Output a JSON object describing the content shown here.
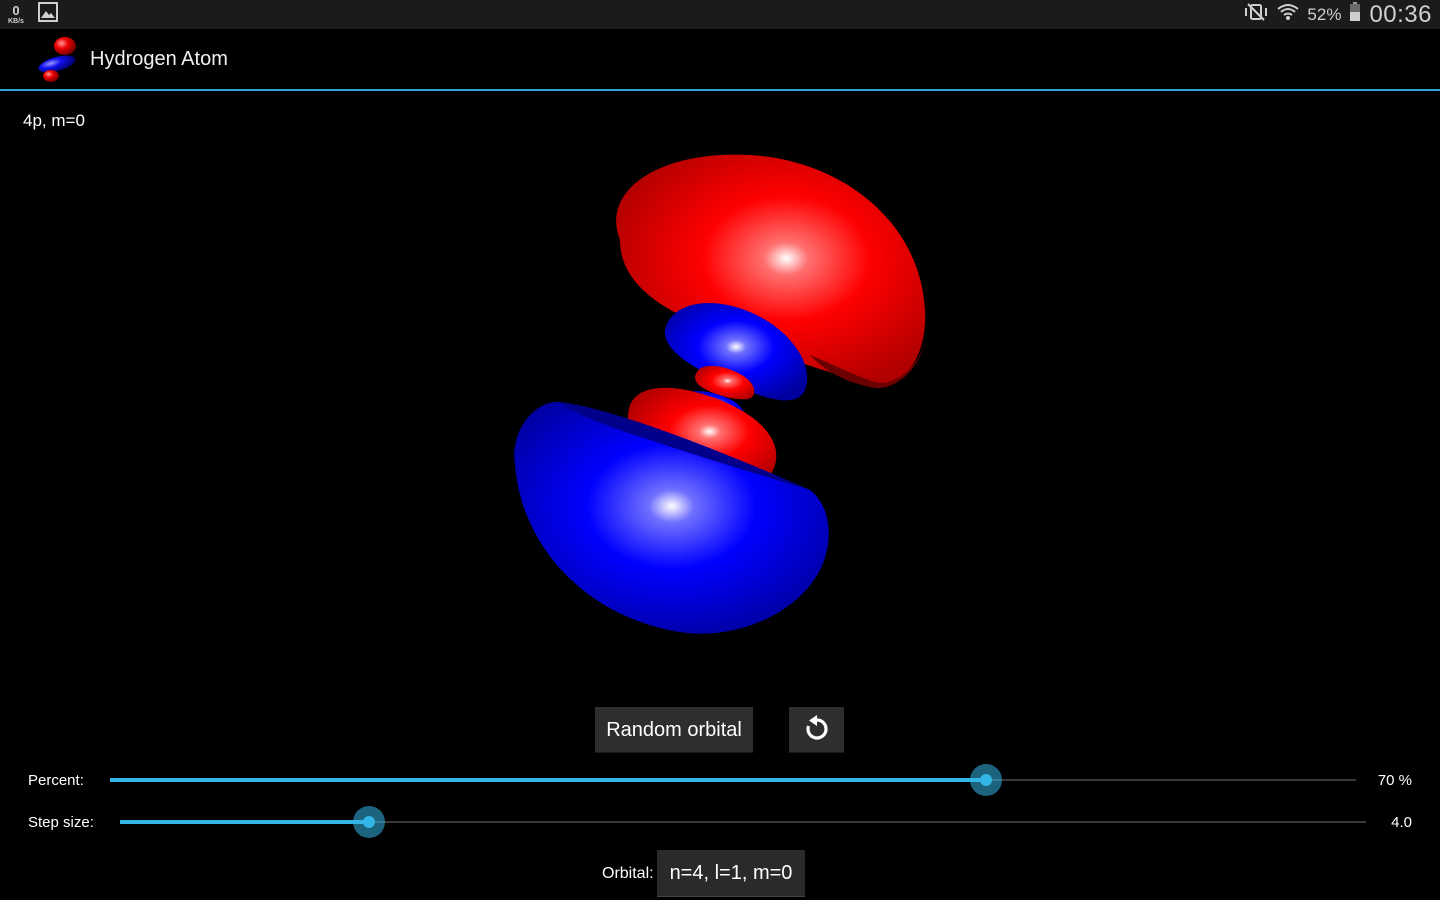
{
  "status_bar": {
    "network_speed": "0",
    "network_unit": "KB/s",
    "battery_percent": "52%",
    "clock": "00:36",
    "icons": [
      "gallery-icon",
      "mute-vibrate-icon",
      "wifi-icon",
      "battery-icon"
    ]
  },
  "action_bar": {
    "title": "Hydrogen Atom",
    "icon": "orbital-app-icon"
  },
  "viewer": {
    "orbital_label": "4p, m=0",
    "colors": {
      "positive": "#ff0000",
      "negative": "#0000ff",
      "background": "#000000"
    }
  },
  "controls": {
    "random_button_label": "Random orbital",
    "reset_icon": "rotate-ccw-icon",
    "percent": {
      "label": "Percent:",
      "value_text": "70 %",
      "value": 70,
      "max": 100
    },
    "step_size": {
      "label": "Step size:",
      "value_text": "4.0",
      "value": 0.2
    },
    "orbital_field_label": "Orbital:",
    "orbital_field_value": "n=4, l=1, m=0"
  },
  "accent_color": "#33b5e5"
}
